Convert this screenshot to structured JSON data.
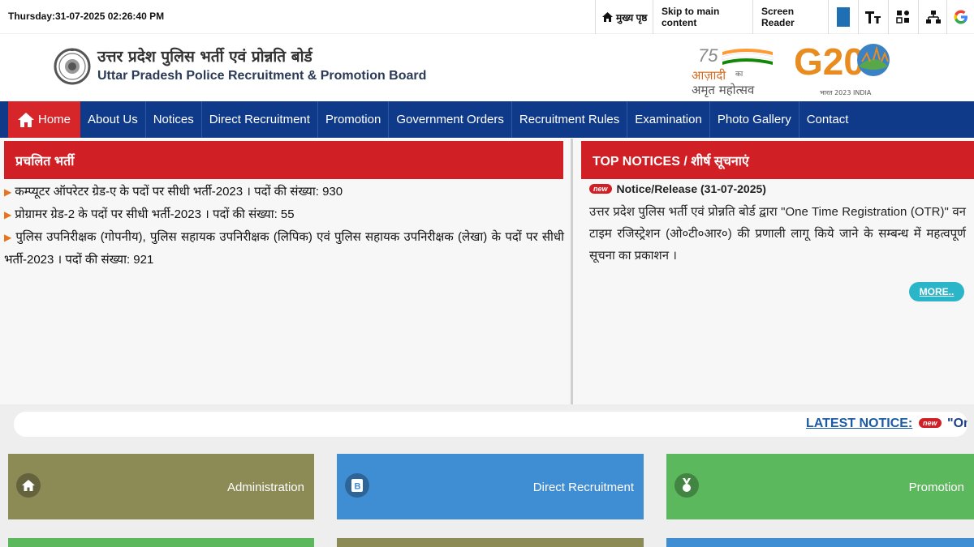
{
  "topbar": {
    "datetime": "Thursday:31-07-2025 02:26:40 PM",
    "home_link": "मुख्य पृष्ठ",
    "skip_link": "Skip to main content",
    "screen_reader": "Screen Reader"
  },
  "header": {
    "title_hindi": "उत्तर प्रदेश पुलिस भर्ती एवं प्रोन्नति बोर्ड",
    "title_english": "Uttar Pradesh Police Recruitment & Promotion Board",
    "azadi_num": "75",
    "azadi_text_1": "आज़ादी",
    "azadi_text_ka": "का",
    "azadi_text_2": "अमृत महोत्सव",
    "g20_text": "G20",
    "g20_sub": "भारत 2023 INDIA"
  },
  "nav": {
    "items": [
      "Home",
      "About Us",
      "Notices",
      "Direct Recruitment",
      "Promotion",
      "Government Orders",
      "Recruitment Rules",
      "Examination",
      "Photo Gallery",
      "Contact"
    ]
  },
  "recruitment": {
    "heading": "प्रचलित भर्ती",
    "items": [
      "कम्प्यूटर ऑपरेटर ग्रेड-ए के पदों पर सीधी भर्ती-2023 । पदों की संख्या: 930",
      "प्रोग्रामर ग्रेड-2 के पदों पर सीधी भर्ती-2023 । पदों की संख्या: 55",
      "पुलिस उपनिरीक्षक (गोपनीय), पुलिस सहायक उपनिरीक्षक (लिपिक) एवं पुलिस सहायक उपनिरीक्षक (लेखा) के पदों पर सीधी भर्ती-2023 । पदों की संख्या: 921"
    ]
  },
  "notices": {
    "heading": "TOP NOTICES / शीर्ष सूचनाएं",
    "badge": "new",
    "title": "Notice/Release (31-07-2025)",
    "body": "उत्तर प्रदेश पुलिस भर्ती एवं प्रोन्नति बोर्ड द्वारा \"One Time Registration (OTR)\" वन टाइम रजिस्ट्रेशन (ओ०टी०आर०) की प्रणाली लागू किये जाने के सम्बन्ध में महत्वपूर्ण सूचना का प्रकाशन ।",
    "more": "MORE.."
  },
  "ticker": {
    "label": "LATEST NOTICE:",
    "badge": "new",
    "text": "\"One T"
  },
  "tiles": [
    {
      "label": "Administration",
      "icon": "home-icon",
      "color": "#8c8a55"
    },
    {
      "label": "Direct Recruitment",
      "icon": "badge-b-icon",
      "color": "#3f8dd3"
    },
    {
      "label": "Promotion",
      "icon": "medal-icon",
      "color": "#5cb85c"
    }
  ],
  "colors": {
    "nav_bg": "#0f3a8a",
    "accent_red": "#d11f26",
    "more_button": "#2ab5c9"
  }
}
